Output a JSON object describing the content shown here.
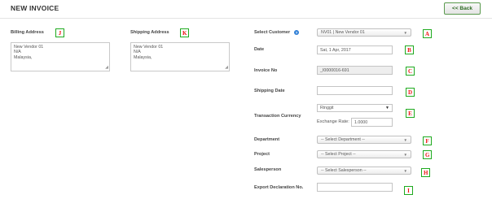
{
  "header": {
    "title": "NEW INVOICE",
    "back_label": "<< Back"
  },
  "billing": {
    "label": "Billing Address",
    "tag": "J",
    "lines": [
      "New Vendor 01",
      "N/A",
      "Malaysia,"
    ]
  },
  "shipping": {
    "label": "Shipping Address",
    "tag": "K",
    "lines": [
      "New Vendor 01",
      "N/A",
      "Malaysia,"
    ]
  },
  "form": {
    "customer": {
      "label": "Select Customer",
      "value": "NV01 | New Vendor 01",
      "tag": "A"
    },
    "date": {
      "label": "Date",
      "value": "Sat, 1 Apr, 2017",
      "tag": "B"
    },
    "invoice_no": {
      "label": "Invoice No",
      "value": "_I0000016-691",
      "tag": "C"
    },
    "shipping_date": {
      "label": "Shipping Date",
      "value": "",
      "tag": "D"
    },
    "currency": {
      "label": "Transaction Currency",
      "value": "Ringgit",
      "exchange_label": "Exchange Rate:",
      "exchange_value": "1.0000",
      "tag": "E"
    },
    "department": {
      "label": "Department",
      "value": "-- Select Department --",
      "tag": "F"
    },
    "project": {
      "label": "Project",
      "value": "-- Select Project --",
      "tag": "G"
    },
    "salesperson": {
      "label": "Salesperson",
      "value": "-- Select Salesperson --",
      "tag": "H"
    },
    "export_decl": {
      "label": "Export Declaration No.",
      "value": "",
      "tag": "I"
    }
  },
  "icons": {
    "help": "question-circle-icon",
    "caret": "chevron-down-icon"
  },
  "colors": {
    "tag_border": "#1faa1f",
    "tag_text": "#ee1111",
    "back_border": "#5a9a4e"
  }
}
